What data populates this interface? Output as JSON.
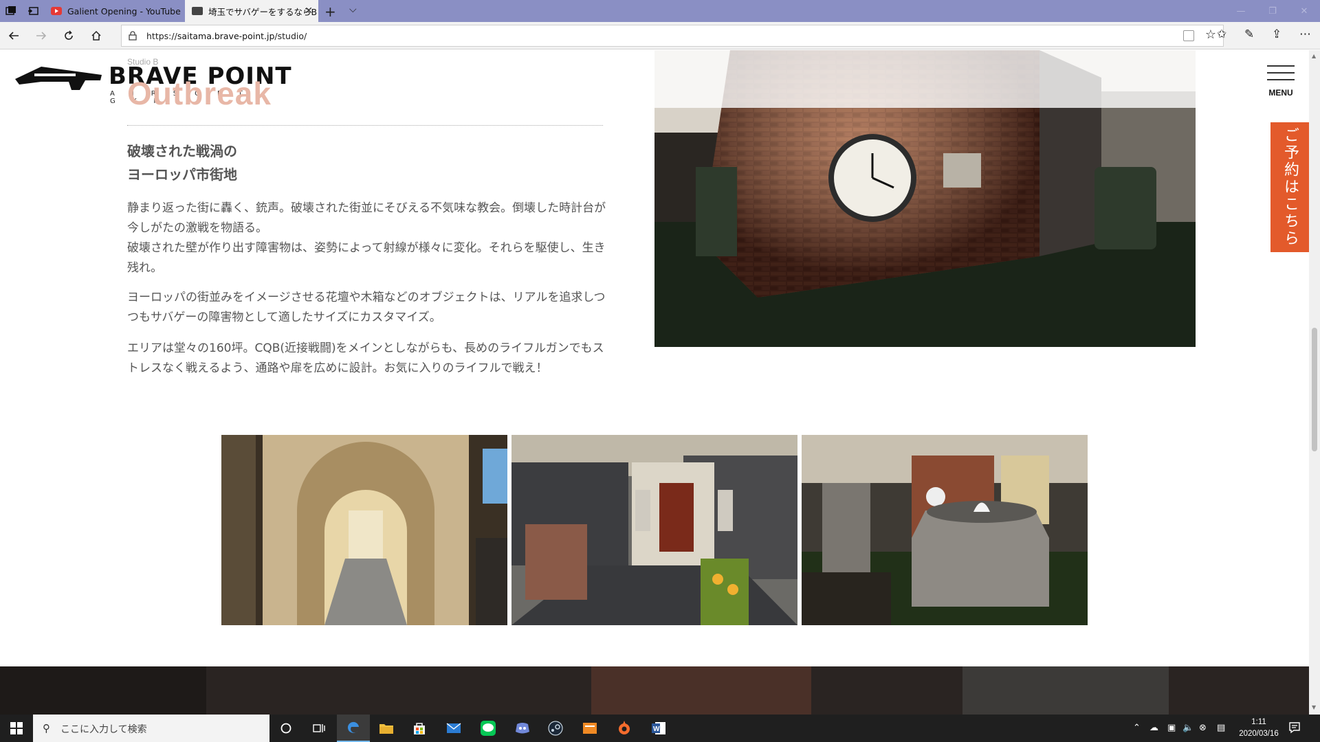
{
  "browser": {
    "tabs": [
      {
        "title": "Galient Opening - YouTube",
        "active": false
      },
      {
        "title": "埼玉でサバゲーをするならB",
        "active": true
      }
    ],
    "url_prefix": "https://",
    "url_host": "saitama.brave-point.jp",
    "url_path": "/studio/",
    "close_glyph": "✕",
    "new_tab_glyph": "+",
    "tab_menu_glyph": "⌵",
    "win_min": "—",
    "win_restore": "❐",
    "win_close": "✕"
  },
  "site": {
    "logo_text": "BRAVE POINT",
    "logo_sub": "AIRSOFT GYM",
    "menu_label": "MENU",
    "reserve_label": "ご予約はこちら"
  },
  "studio": {
    "label": "Studio B",
    "name": "Outbreak",
    "heading_line1": "破壊された戦渦の",
    "heading_line2": "ヨーロッパ市街地",
    "para1_line1": "静まり返った街に轟く、銃声。破壊された街並にそびえる不気味な教会。倒壊した時計台が",
    "para1_line2": "今しがたの激戦を物語る。",
    "para1_line3": "破壊された壁が作り出す障害物は、姿勢によって射線が様々に変化。それらを駆使し、生き",
    "para1_line4": "残れ。",
    "para2_line1": "ヨーロッパの街並みをイメージさせる花壇や木箱などのオブジェクトは、リアルを追求しつ",
    "para2_line2": "つもサバゲーの障害物として適したサイズにカスタマイズ。",
    "para3_line1": "エリアは堂々の160坪。CQB(近接戦闘)をメインとしながらも、長めのライフルガンでもス",
    "para3_line2": "トレスなく戦えるよう、通路や扉を広めに設計。お気に入りのライフルで戦え！"
  },
  "taskbar": {
    "search_placeholder": "ここに入力して検索",
    "time": "1:11",
    "date": "2020/03/16"
  },
  "colors": {
    "accent": "#e35a2b",
    "titlebar": "#8a8fc4",
    "studio_name": "#e8b7a7"
  }
}
